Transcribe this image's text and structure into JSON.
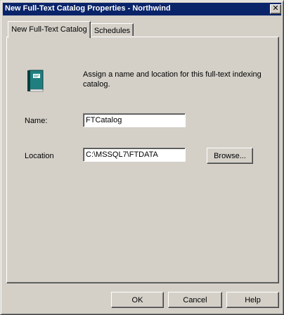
{
  "window": {
    "title": "New Full-Text Catalog Properties - Northwind",
    "close_glyph": "✕"
  },
  "tabs": [
    {
      "label": "New Full-Text Catalog",
      "active": true
    },
    {
      "label": "Schedules",
      "active": false
    }
  ],
  "general": {
    "icon": "catalog-book-icon",
    "description": "Assign a name and location for this full-text indexing catalog.",
    "name_label": "Name:",
    "name_value": "FTCatalog",
    "location_label": "Location",
    "location_value": "C:\\MSSQL7\\FTDATA",
    "browse_label": "Browse..."
  },
  "buttons": {
    "ok": "OK",
    "cancel": "Cancel",
    "help": "Help"
  },
  "colors": {
    "titlebar": "#0a246a",
    "face": "#d4d0c8",
    "icon_book": "#1f6b6b"
  }
}
